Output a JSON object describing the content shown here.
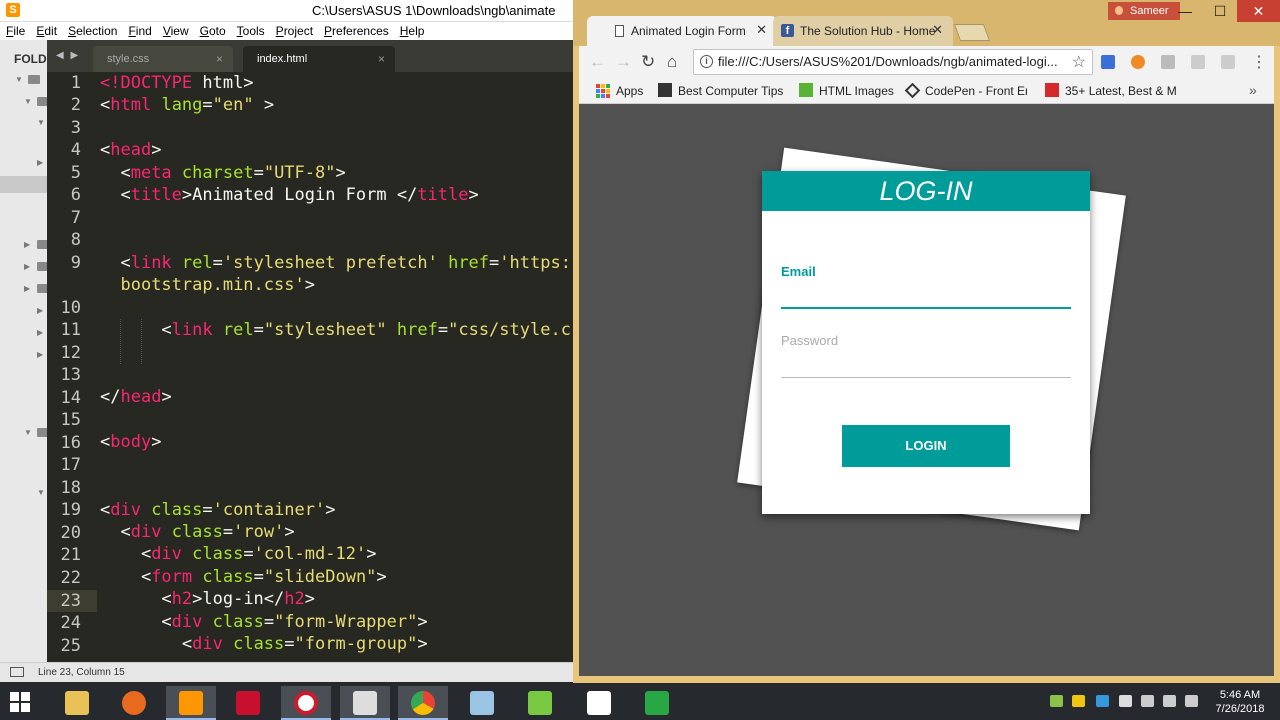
{
  "sublime": {
    "title": "C:\\Users\\ASUS 1\\Downloads\\ngb\\animate",
    "menu": [
      "File",
      "Edit",
      "Selection",
      "Find",
      "View",
      "Goto",
      "Tools",
      "Project",
      "Preferences",
      "Help"
    ],
    "sidebar_header": "FOLD",
    "tabs": [
      {
        "label": "style.css",
        "active": false
      },
      {
        "label": "index.html",
        "active": true
      }
    ],
    "line_numbers": [
      "1",
      "2",
      "3",
      "4",
      "5",
      "6",
      "7",
      "8",
      "9",
      "",
      "10",
      "11",
      "12",
      "13",
      "14",
      "15",
      "16",
      "17",
      "18",
      "19",
      "20",
      "21",
      "22",
      "23",
      "24",
      "25"
    ],
    "current_line": "23",
    "status": "Line 23, Column 15"
  },
  "chrome": {
    "user": "Sameer",
    "tabs": [
      {
        "label": "Animated Login Form",
        "active": true
      },
      {
        "label": "The Solution Hub - Home",
        "active": false
      }
    ],
    "address": "file:///C:/Users/ASUS%201/Downloads/ngb/animated-logi...",
    "bookmarks": [
      "Apps",
      "Best Computer Tips",
      "HTML Images",
      "CodePen - Front End",
      "35+ Latest, Best & M"
    ],
    "more": "»"
  },
  "login": {
    "title": "LOG-IN",
    "email_label": "Email",
    "password_label": "Password",
    "button": "LOGIN"
  },
  "colors": {
    "accent": "#009c9a",
    "editor_bg": "#272822",
    "tag": "#f92672",
    "attr": "#a6e22e",
    "string": "#e6db74",
    "page_bg": "#525252"
  },
  "taskbar": {
    "time": "5:46 AM",
    "date": "7/26/2018"
  }
}
